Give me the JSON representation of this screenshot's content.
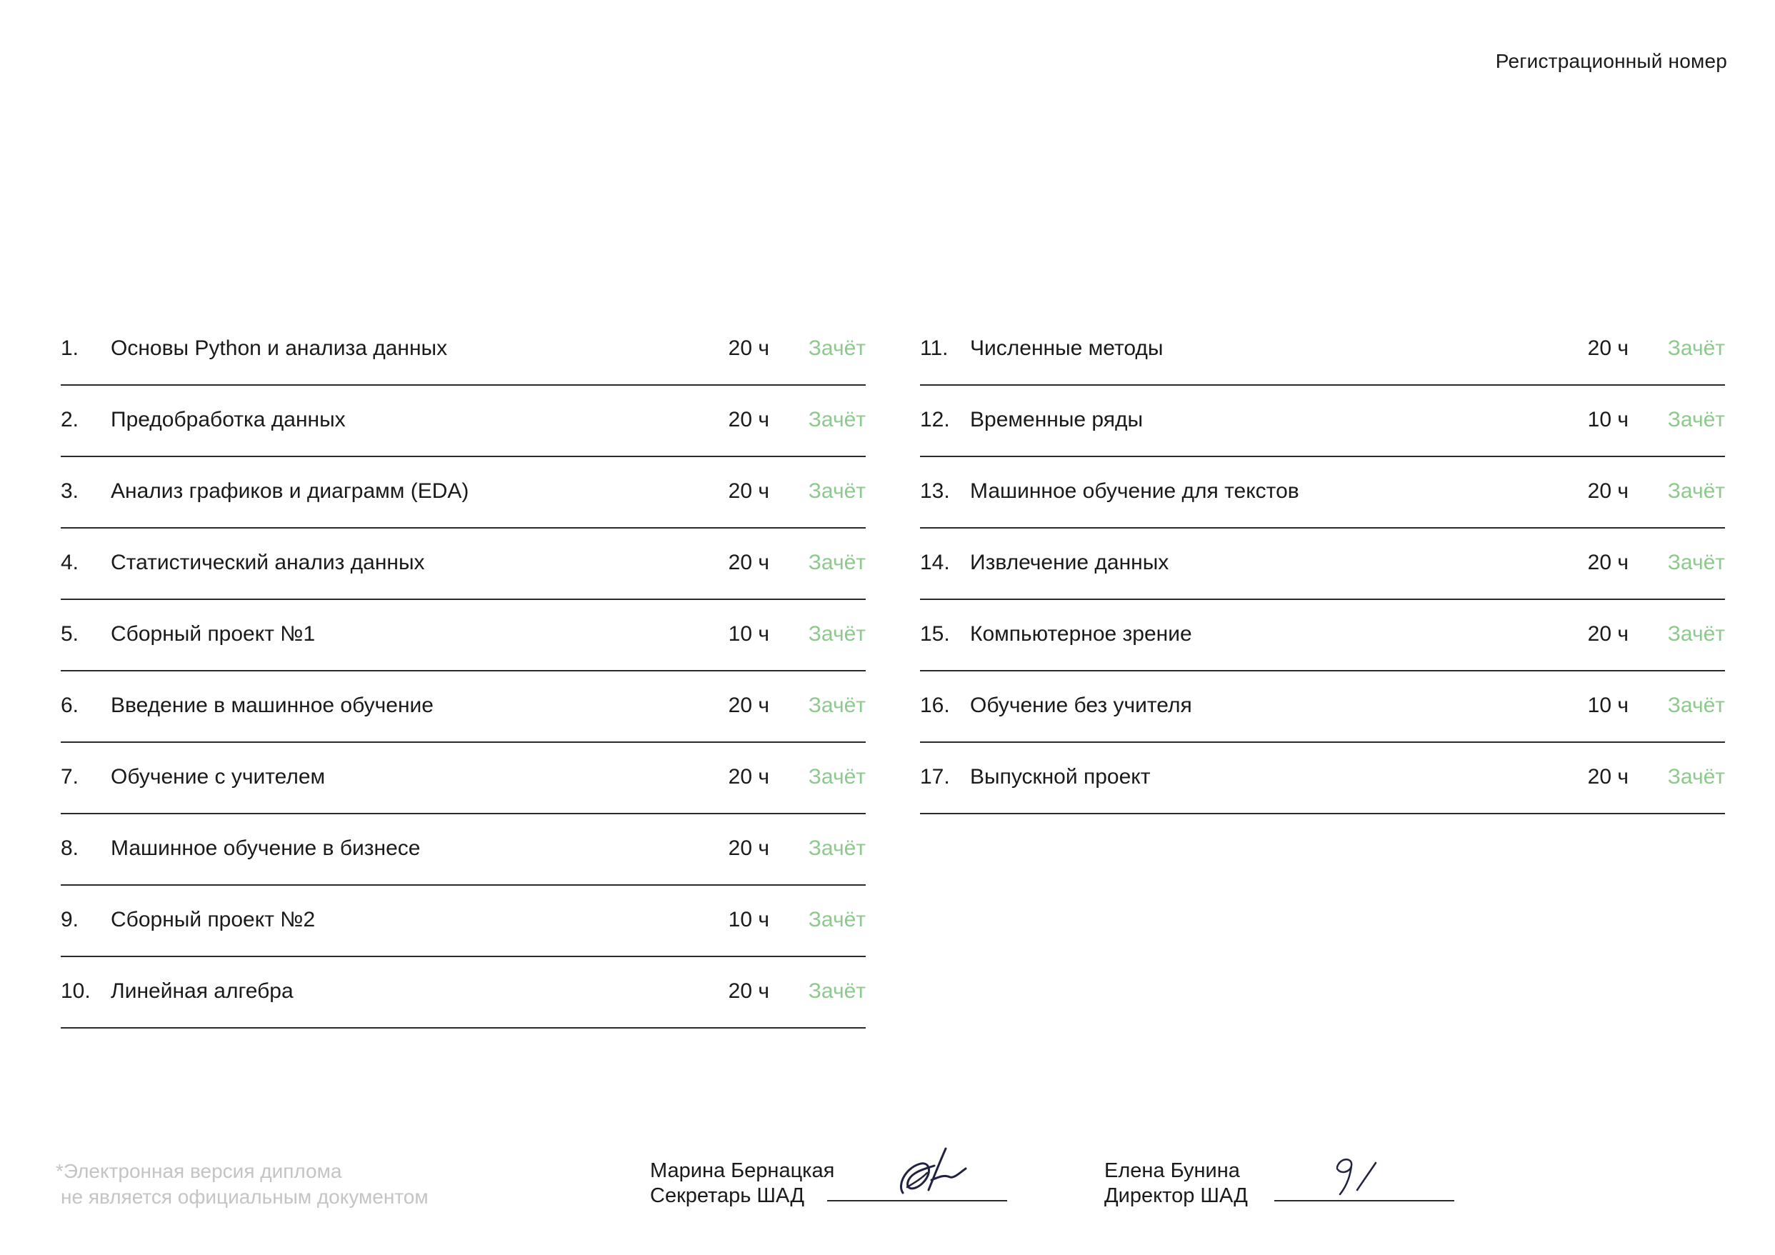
{
  "header": {
    "registration_label": "Регистрационный номер"
  },
  "courses_left": [
    {
      "num": "1.",
      "name": "Основы Python и анализа данных",
      "hours": "20 ч",
      "status": "Зачёт"
    },
    {
      "num": "2.",
      "name": "Предобработка данных",
      "hours": "20 ч",
      "status": "Зачёт"
    },
    {
      "num": "3.",
      "name": "Анализ графиков и диаграмм (EDA)",
      "hours": "20 ч",
      "status": "Зачёт"
    },
    {
      "num": "4.",
      "name": "Статистический анализ данных",
      "hours": "20 ч",
      "status": "Зачёт"
    },
    {
      "num": "5.",
      "name": "Сборный проект №1",
      "hours": "10 ч",
      "status": "Зачёт"
    },
    {
      "num": "6.",
      "name": "Введение в машинное обучение",
      "hours": "20 ч",
      "status": "Зачёт"
    },
    {
      "num": "7.",
      "name": "Обучение с учителем",
      "hours": "20 ч",
      "status": "Зачёт"
    },
    {
      "num": "8.",
      "name": "Машинное обучение в бизнесе",
      "hours": "20 ч",
      "status": "Зачёт"
    },
    {
      "num": "9.",
      "name": "Сборный проект №2",
      "hours": "10 ч",
      "status": "Зачёт"
    },
    {
      "num": "10.",
      "name": "Линейная алгебра",
      "hours": "20 ч",
      "status": "Зачёт"
    }
  ],
  "courses_right": [
    {
      "num": "11.",
      "name": "Численные методы",
      "hours": "20 ч",
      "status": "Зачёт"
    },
    {
      "num": "12.",
      "name": "Временные ряды",
      "hours": "10 ч",
      "status": "Зачёт"
    },
    {
      "num": "13.",
      "name": "Машинное обучение для текстов",
      "hours": "20 ч",
      "status": "Зачёт"
    },
    {
      "num": "14.",
      "name": "Извлечение данных",
      "hours": "20 ч",
      "status": "Зачёт"
    },
    {
      "num": "15.",
      "name": "Компьютерное зрение",
      "hours": "20 ч",
      "status": "Зачёт"
    },
    {
      "num": "16.",
      "name": "Обучение без учителя",
      "hours": "10 ч",
      "status": "Зачёт"
    },
    {
      "num": "17.",
      "name": "Выпускной проект",
      "hours": "20 ч",
      "status": "Зачёт"
    }
  ],
  "footer": {
    "disclaimer_line1": "*Электронная версия диплома",
    "disclaimer_line2": "не является официальным документом",
    "signer1_name": "Марина Бернацкая",
    "signer1_title": "Секретарь ШАД",
    "signer2_name": "Елена Бунина",
    "signer2_title": "Директор ШАД"
  },
  "colors": {
    "status_green": "#8cc98c",
    "text": "#1a1a1a",
    "disclaimer_gray": "#c4c4c4"
  }
}
